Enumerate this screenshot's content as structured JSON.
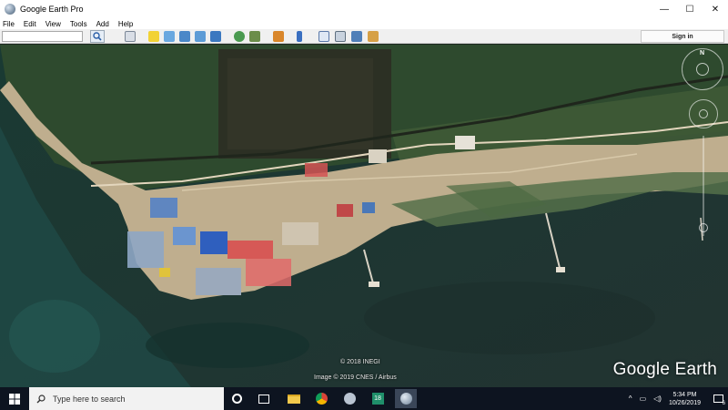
{
  "window": {
    "title": "Google Earth Pro",
    "minimize_glyph": "—",
    "maximize_glyph": "☐",
    "close_glyph": "✕"
  },
  "menu": [
    "File",
    "Edit",
    "View",
    "Tools",
    "Add",
    "Help"
  ],
  "toolbar": {
    "search_value": "",
    "signin_label": "Sign in",
    "icons": [
      "sidebar-icon",
      "placemark-icon",
      "polygon-icon",
      "path-icon",
      "image-overlay-icon",
      "record-tour-icon",
      "historical-imagery-icon",
      "sunlight-icon",
      "planets-icon",
      "ruler-icon",
      "email-icon",
      "print-icon",
      "save-image-icon",
      "maps-icon"
    ]
  },
  "map": {
    "attribution_1": "© 2018 INEGI",
    "attribution_2": "Image © 2019 CNES / Airbus",
    "logo": "Google Earth",
    "compass_label": "N"
  },
  "taskbar": {
    "search_placeholder": "Type here to search",
    "time": "5:34 PM",
    "date": "10/26/2019",
    "notification_count": "6",
    "badge_18": "18"
  },
  "colors": {
    "taskbar": "#0d1420",
    "water_dark": "#12302e",
    "mangrove": "#2f4a2c",
    "sand": "#c9b99c"
  }
}
